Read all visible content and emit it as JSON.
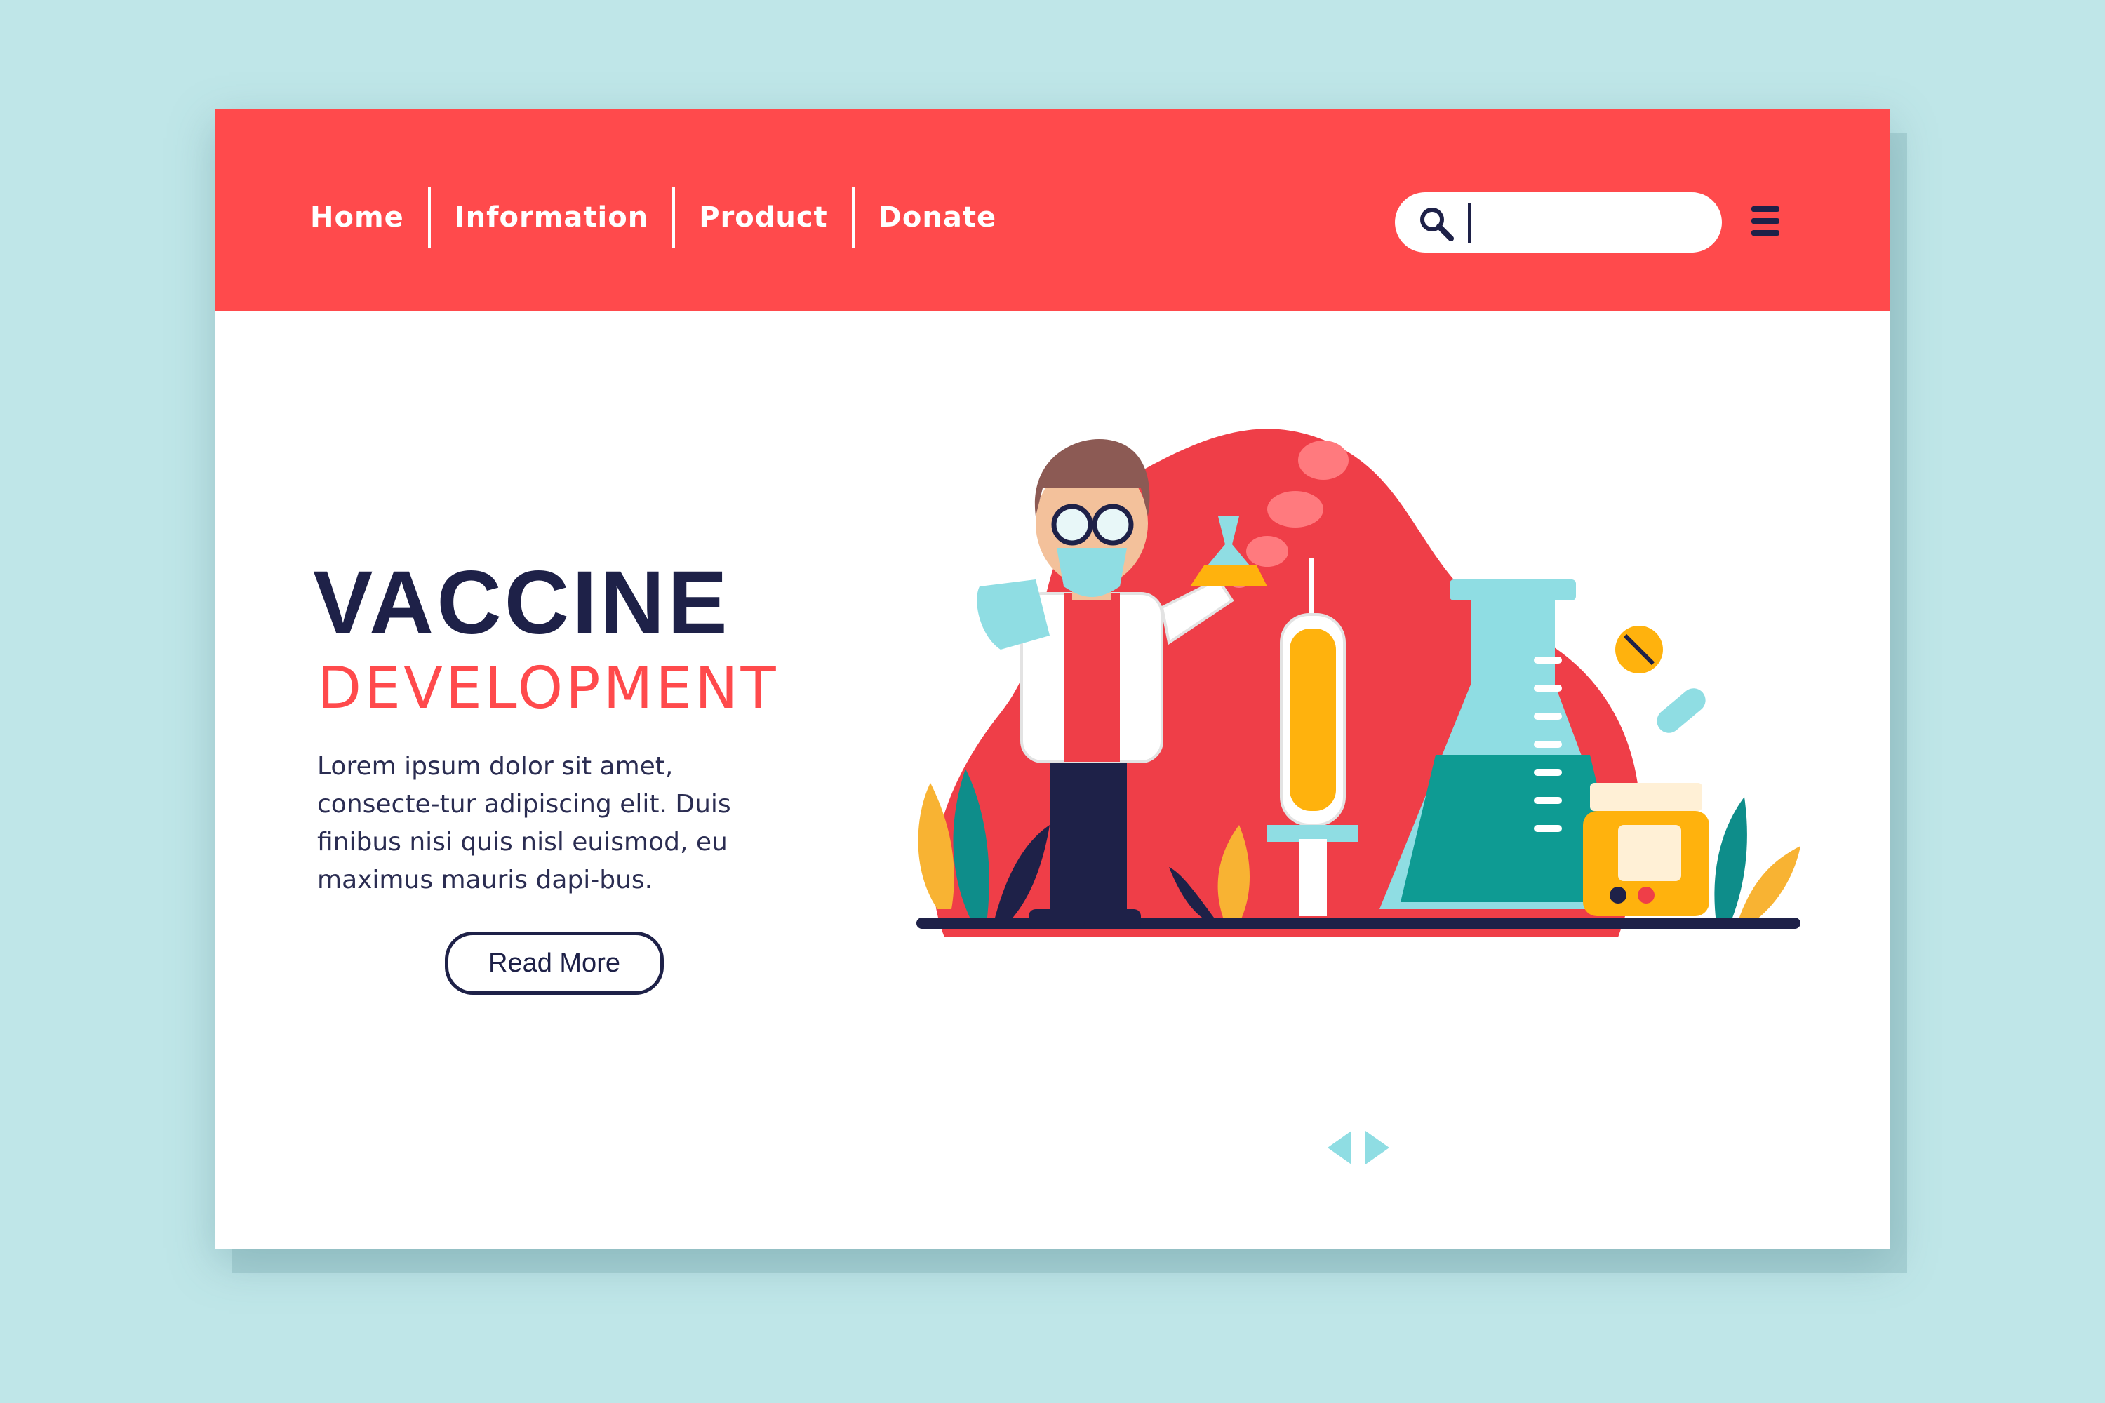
{
  "nav": {
    "items": [
      {
        "label": "Home"
      },
      {
        "label": "Information"
      },
      {
        "label": "Product"
      },
      {
        "label": "Donate"
      }
    ]
  },
  "search": {
    "value": "",
    "placeholder": ""
  },
  "hero": {
    "title": "VACCINE",
    "subtitle": "DEVELOPMENT",
    "description": "Lorem ipsum dolor sit amet, consecte-tur adipiscing elit. Duis finibus nisi quis nisl euismod, eu maximus mauris dapi-bus.",
    "cta_label": "Read More"
  },
  "colors": {
    "header": "#ff4a4c",
    "navy": "#1e2148",
    "accent_red": "#ff4a4c",
    "background": "#bfe6e8",
    "arrow": "#8fdde3"
  },
  "icons": [
    "search-icon",
    "hamburger-menu-icon",
    "arrow-left-icon",
    "arrow-right-icon"
  ]
}
